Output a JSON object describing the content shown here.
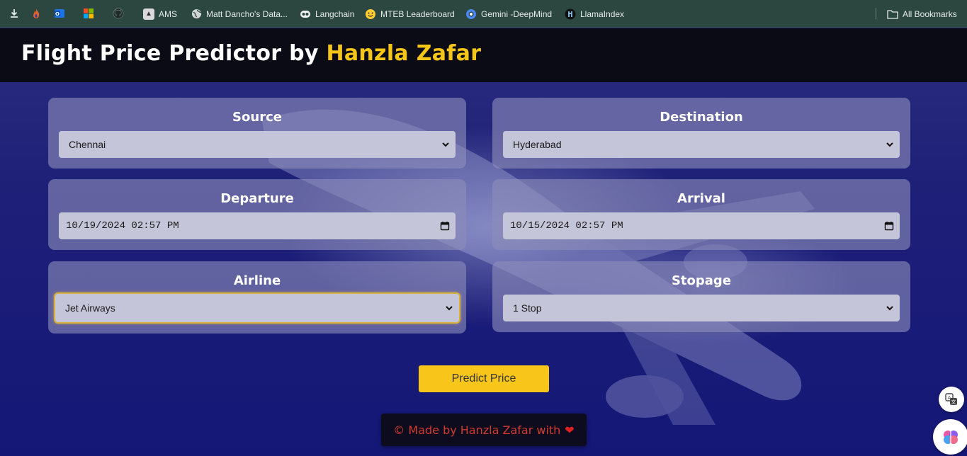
{
  "bookmarks": {
    "items": [
      {
        "label": "AMS",
        "icon": "ams-icon"
      },
      {
        "label": "Matt Dancho's Data...",
        "icon": "globe-icon"
      },
      {
        "label": "Langchain",
        "icon": "langchain-icon"
      },
      {
        "label": "MTEB Leaderboard",
        "icon": "huggingface-icon"
      },
      {
        "label": "Gemini -DeepMind",
        "icon": "gemini-icon"
      },
      {
        "label": "LlamaIndex",
        "icon": "llama-icon"
      }
    ],
    "all_bookmarks": "All Bookmarks"
  },
  "header": {
    "title_main": "Flight Price Predictor by ",
    "title_highlight": "Hanzla Zafar"
  },
  "form": {
    "source": {
      "label": "Source",
      "value": "Chennai"
    },
    "destination": {
      "label": "Destination",
      "value": "Hyderabad"
    },
    "departure": {
      "label": "Departure",
      "value": "10/19/2024 02:57 PM"
    },
    "arrival": {
      "label": "Arrival",
      "value": "10/15/2024 02:57 PM"
    },
    "airline": {
      "label": "Airline",
      "value": "Jet Airways"
    },
    "stopage": {
      "label": "Stopage",
      "value": "1 Stop"
    }
  },
  "predict_label": "Predict Price",
  "footer": {
    "text": "© Made by Hanzla Zafar with",
    "heart": "❤"
  },
  "colors": {
    "accent": "#f5c518",
    "button": "#f8c51a",
    "header_bg": "#0b0b16",
    "page_bg": "#1d1f78",
    "footer_text": "#d43b2e"
  }
}
